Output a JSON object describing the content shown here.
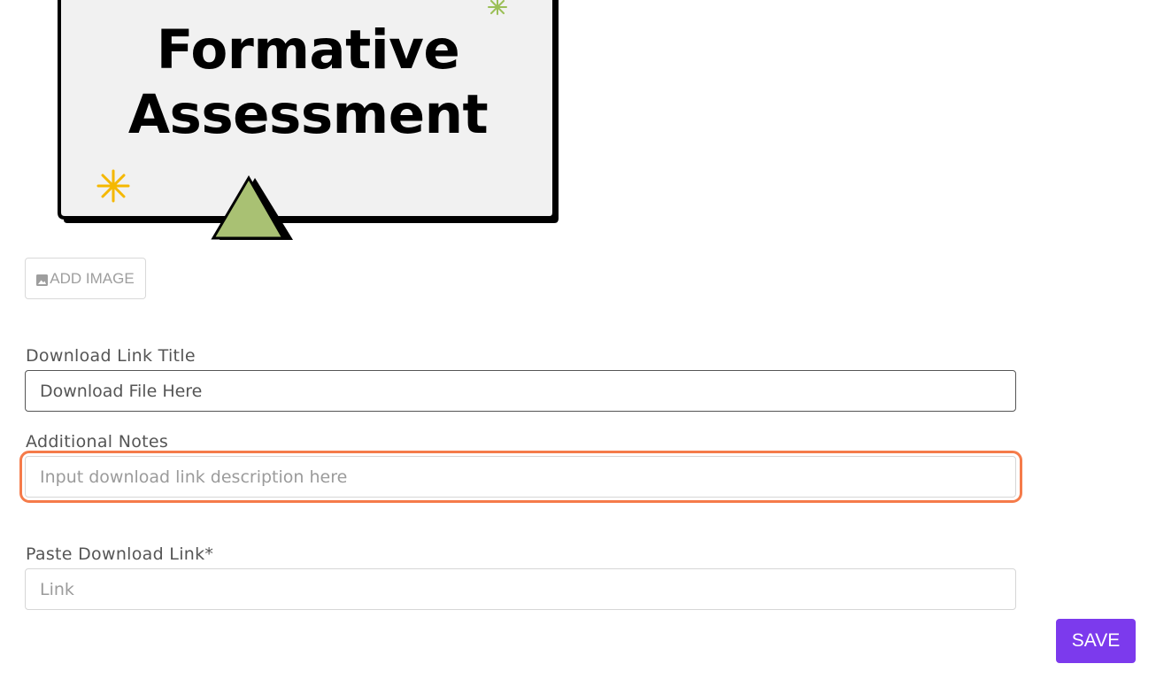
{
  "banner": {
    "title_line1": "Formative",
    "title_line2": "Assessment"
  },
  "add_image": {
    "label": "ADD IMAGE",
    "icon": "image-icon"
  },
  "form": {
    "download_link_title": {
      "label": "Download Link Title",
      "value": "Download File Here"
    },
    "additional_notes": {
      "label": "Additional Notes",
      "placeholder": "Input download link description here",
      "value": ""
    },
    "download_link": {
      "label": "Paste Download Link*",
      "placeholder": "Link",
      "value": ""
    }
  },
  "save": {
    "label": "SAVE"
  },
  "colors": {
    "accent": "#7c3aed",
    "focus_ring": "#f57b4a",
    "banner_bg": "#f1f1f1",
    "triangle": "#a9c173",
    "sparkle_yellow": "#f5b800",
    "sparkle_green": "#9bbf57"
  }
}
